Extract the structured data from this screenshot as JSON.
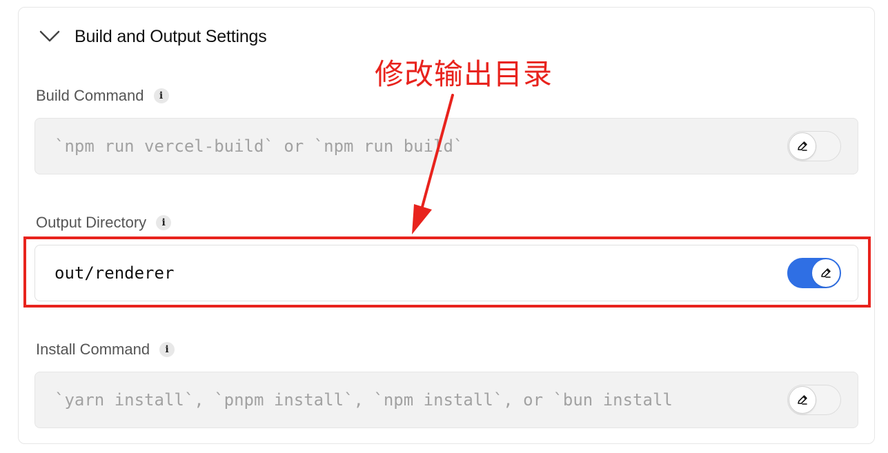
{
  "section": {
    "title": "Build and Output Settings",
    "expanded": true
  },
  "fields": {
    "build_command": {
      "label": "Build Command",
      "placeholder": "`npm run vercel-build` or `npm run build`",
      "override": false
    },
    "output_directory": {
      "label": "Output Directory",
      "value": "out/renderer",
      "override": true
    },
    "install_command": {
      "label": "Install Command",
      "placeholder": "`yarn install`, `pnpm install`, `npm install`, or `bun install",
      "override": false
    }
  },
  "annotation": {
    "text": "修改输出目录",
    "color": "#e8231d"
  },
  "colors": {
    "accent": "#2f6fe4",
    "annotation_red": "#e8231d"
  },
  "icons": {
    "chevron": "chevron-down-icon",
    "info": "info-icon",
    "edit": "pencil-icon"
  }
}
